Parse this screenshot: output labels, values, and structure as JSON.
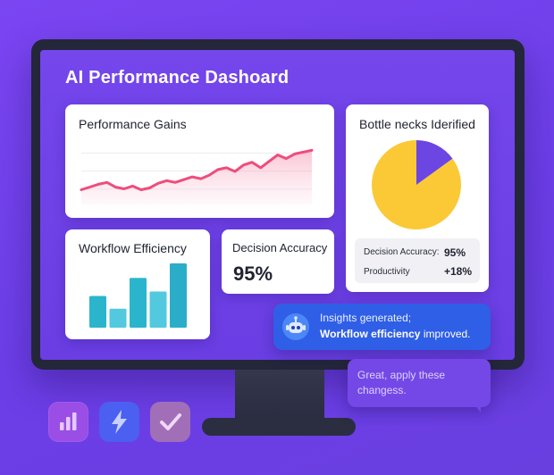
{
  "dashboard": {
    "title": "AI Performance Dashoard"
  },
  "cards": {
    "performance": {
      "title": "Performance Gains"
    },
    "bottlenecks": {
      "title": "Bottle necks Iderified",
      "stats": [
        {
          "label": "Decision Accuracy:",
          "value": "95%"
        },
        {
          "label": "Productivity",
          "value": "+18%"
        }
      ]
    },
    "workflow": {
      "title": "Workflow Efficiency"
    },
    "decision": {
      "title": "Decision Accuracy",
      "value": "95%"
    }
  },
  "insight": {
    "line1": "Insights generated;",
    "line2_bold": "Workflow efficiency",
    "line2_rest": " improved."
  },
  "reply": {
    "text": "Great, apply these changess."
  },
  "icons": [
    "bar-chart-app-icon",
    "lightning-app-icon",
    "check-app-icon"
  ],
  "colors": {
    "background": "#7444ee",
    "line": "#ee4d7c",
    "pie_major": "#fbc936",
    "pie_minor": "#6b46e3",
    "bars": "#2ab4cc",
    "insight": "#2f5fe6"
  },
  "chart_data": [
    {
      "type": "line",
      "name": "performance-gains",
      "x": [
        0,
        1,
        2,
        3,
        4,
        5,
        6,
        7,
        8,
        9,
        10,
        11,
        12,
        13,
        14,
        15,
        16,
        17,
        18,
        19,
        20,
        21,
        22,
        23,
        24,
        25,
        26,
        27
      ],
      "values": [
        16,
        19,
        22,
        24,
        19,
        17,
        20,
        16,
        18,
        23,
        26,
        24,
        27,
        30,
        28,
        32,
        38,
        40,
        36,
        43,
        46,
        40,
        47,
        54,
        50,
        55,
        57,
        59
      ],
      "ylim": [
        0,
        70
      ],
      "grid": true
    },
    {
      "type": "pie",
      "name": "bottlenecks-identified",
      "values": [
        85,
        15
      ]
    },
    {
      "type": "bar",
      "name": "workflow-efficiency",
      "values": [
        35,
        21,
        55,
        40,
        71
      ],
      "ylim": [
        0,
        75
      ],
      "shades": [
        "#2bb5cc",
        "#52c9de",
        "#2bb5cc",
        "#52c9de",
        "#2aadc8"
      ]
    }
  ]
}
